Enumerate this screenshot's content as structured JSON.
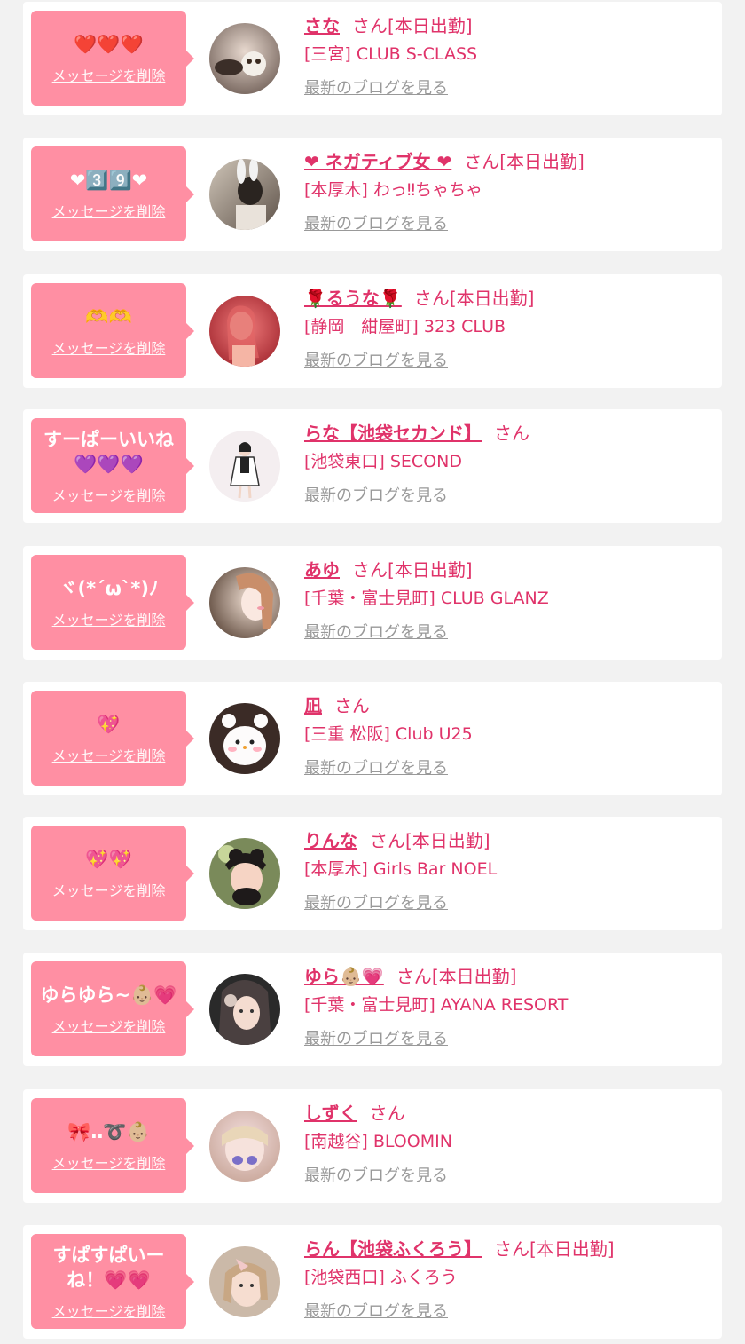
{
  "delete_label": "メッセージを削除",
  "blog_label": "最新のブログを見る",
  "san_label": "さん",
  "colors": {
    "accent": "#e0336a",
    "bubble": "#ff8fa3",
    "background": "#f2f2f2",
    "muted": "#999999"
  },
  "items": [
    {
      "message": "❤️❤️❤️",
      "name": "さな",
      "status": "[本日出勤]",
      "shop": "[三宮] CLUB S-CLASS"
    },
    {
      "message": "❤︎3️⃣9️⃣❤︎",
      "name": "❤︎ ネガティブ女 ❤︎",
      "status": "[本日出勤]",
      "shop": "[本厚木] わっ‼ちゃちゃ"
    },
    {
      "message": "🫶🫶",
      "name": "🌹るうな🌹",
      "status": "[本日出勤]",
      "shop": "[静岡　紺屋町] 323 CLUB"
    },
    {
      "message": "すーぱーいいね💜💜💜",
      "name": "らな【池袋セカンド】",
      "status": "",
      "shop": "[池袋東口] SECOND"
    },
    {
      "message": "ヾ(*´ω`*)ﾉ",
      "name": "あゆ",
      "status": "[本日出勤]",
      "shop": "[千葉・富士見町] CLUB GLANZ"
    },
    {
      "message": "💖",
      "name": "凪",
      "status": "",
      "shop": "[三重 松阪] Club U25"
    },
    {
      "message": "💖💖",
      "name": "りんな",
      "status": "[本日出勤]",
      "shop": "[本厚木] Girls Bar NOEL"
    },
    {
      "message": "ゆらゆら~👶🏼💗",
      "name": "ゆら👶🏼💗",
      "status": "[本日出勤]",
      "shop": "[千葉・富士見町] AYANA RESORT"
    },
    {
      "message": "🎀‥➰👶🏼",
      "name": "しずく",
      "status": "",
      "shop": "[南越谷] BLOOMIN"
    },
    {
      "message": "すぱすぱいーね！💗💗",
      "name": "らん【池袋ふくろう】",
      "status": "[本日出勤]",
      "shop": "[池袋西口] ふくろう"
    }
  ]
}
